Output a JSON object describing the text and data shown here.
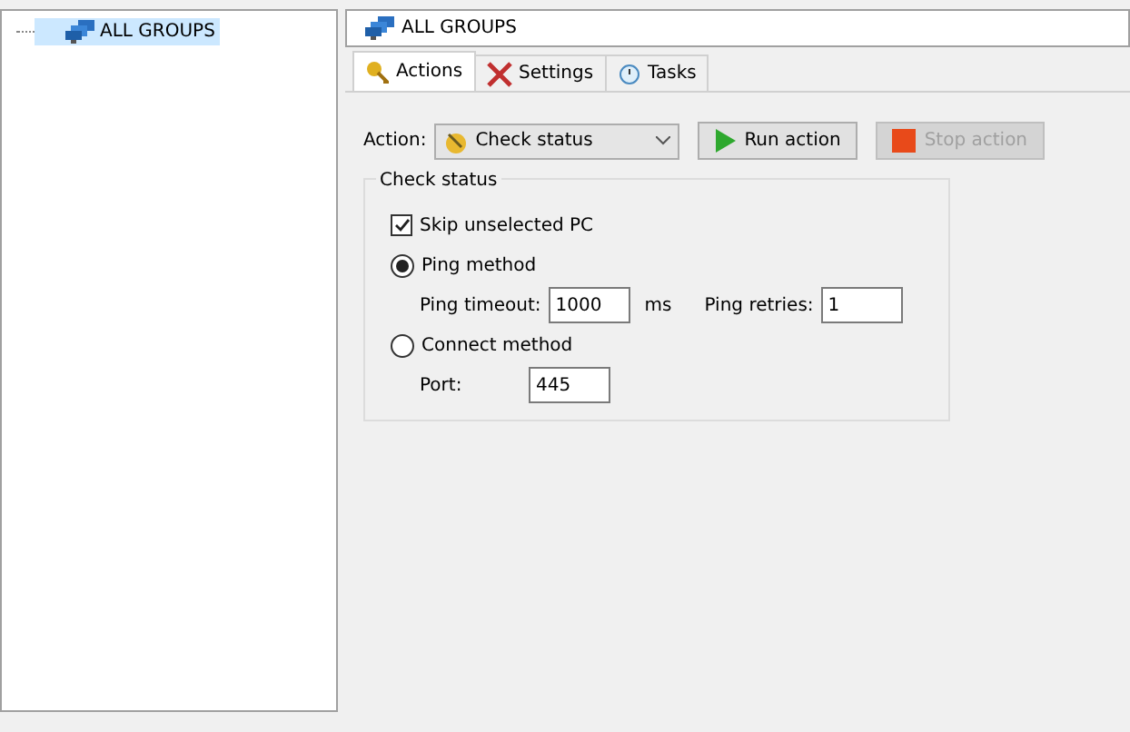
{
  "tree": {
    "items": [
      {
        "label": "ALL GROUPS",
        "selected": true
      }
    ]
  },
  "header": {
    "title": "ALL GROUPS"
  },
  "tabs": [
    {
      "label": "Actions",
      "kind": "actions",
      "selected": true
    },
    {
      "label": "Settings",
      "kind": "settings",
      "selected": false
    },
    {
      "label": "Tasks",
      "kind": "tasks",
      "selected": false
    }
  ],
  "action_bar": {
    "label": "Action:",
    "value": "Check status",
    "run_button": {
      "label": "Run action",
      "disabled": false
    },
    "stop_button": {
      "label": "Stop action",
      "disabled": true
    }
  },
  "group": {
    "title": "Check status",
    "skip_unselected": {
      "label": "Skip unselected PC",
      "checked": true
    },
    "ping_method": {
      "label": "Ping method",
      "selected": true,
      "timeout_label": "Ping timeout:",
      "timeout": "1000",
      "unit": "ms",
      "retries_label": "Ping retries:",
      "retries": "1"
    },
    "connect_method": {
      "label": "Connect method",
      "selected": false,
      "port_label": "Port:",
      "port": "445"
    }
  }
}
